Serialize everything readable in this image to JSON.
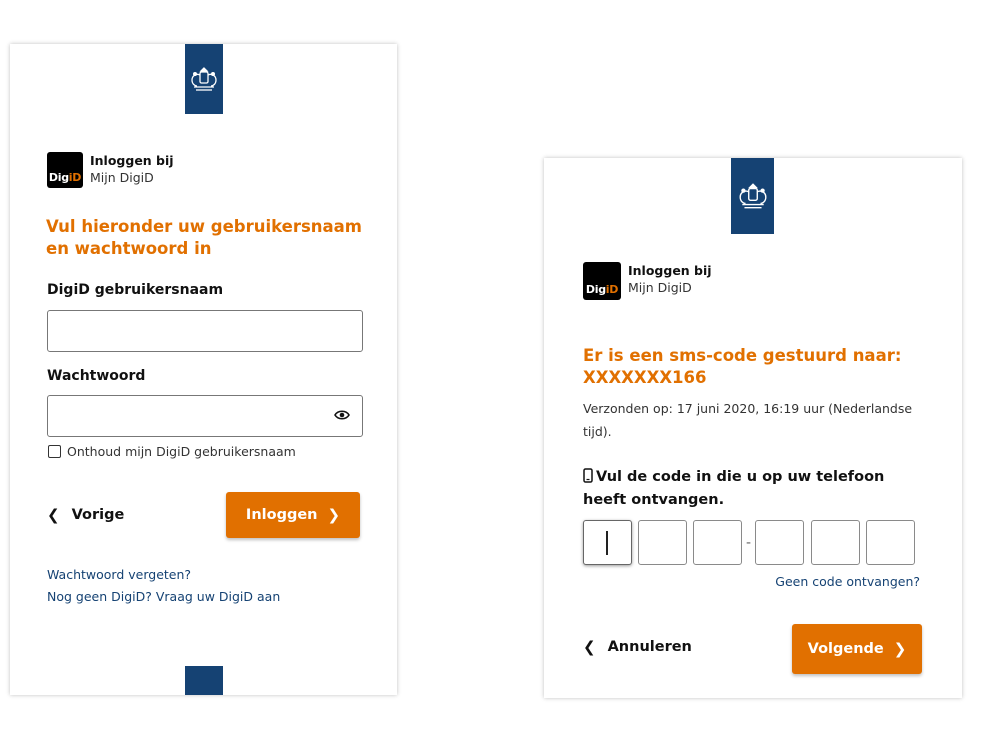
{
  "colors": {
    "brand_blue": "#154273",
    "accent_orange": "#e17000",
    "link_blue": "#154273"
  },
  "left": {
    "login_to_label": "Inloggen bij",
    "service_name": "Mijn DigiD",
    "digid_logo_text_a": "Dig",
    "digid_logo_text_b": "iD",
    "heading": "Vul hieronder uw gebruikersnaam en wachtwoord in",
    "username_label": "DigiD gebruikersnaam",
    "username_value": "",
    "password_label": "Wachtwoord",
    "password_value": "",
    "show_password_icon": "eye-icon",
    "remember_label": "Onthoud mijn DigiD gebruikersnaam",
    "remember_checked": false,
    "back_label": "Vorige",
    "login_button_label": "Inloggen",
    "forgot_password_link": "Wachtwoord vergeten?",
    "no_digid_link": "Nog geen DigiD? Vraag uw DigiD aan"
  },
  "right": {
    "login_to_label": "Inloggen bij",
    "service_name": "Mijn DigiD",
    "digid_logo_text_a": "Dig",
    "digid_logo_text_b": "iD",
    "heading": "Er is een sms-code gestuurd naar: XXXXXXX166",
    "sent_text": "Verzonden op: 17 juni 2020, 16:19 uur (Nederlandse tijd).",
    "code_instruction": "Vul de code in die u op uw telefoon heeft ontvangen.",
    "phone_icon": "phone-icon",
    "code_digits": [
      "",
      "",
      "",
      "",
      "",
      ""
    ],
    "code_separator": "-",
    "no_code_link": "Geen code ontvangen?",
    "cancel_label": "Annuleren",
    "next_button_label": "Volgende"
  }
}
